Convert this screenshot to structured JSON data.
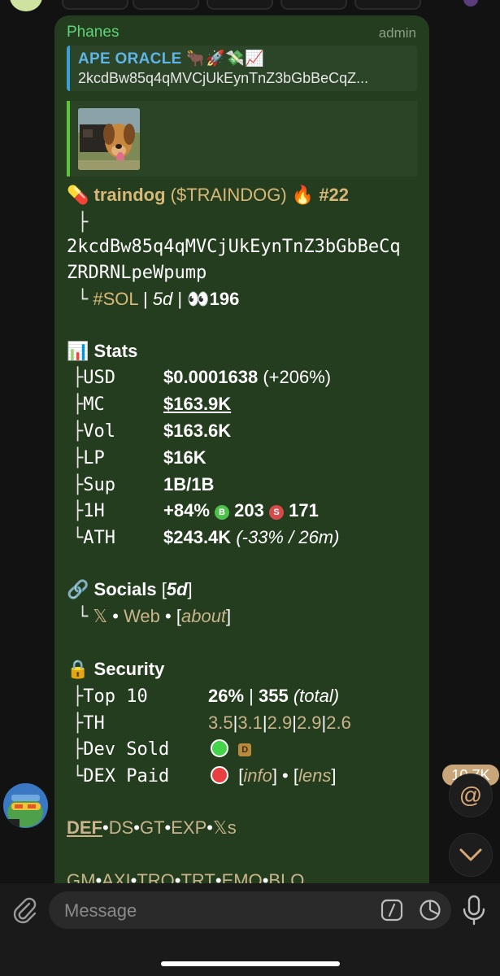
{
  "message": {
    "sender": "Phanes",
    "role": "admin",
    "reply": {
      "title": "APE ORACLE 🐂🚀💸📈",
      "text": "2kcdBw85q4qMVCjUkEynTnZ3bGbBeCqZ..."
    },
    "token": {
      "emoji": "💊",
      "name": "traindog",
      "ticker": "($TRAINDOG)",
      "rank_icon": "🔥",
      "rank": "#22",
      "address_line1": "2kcdBw85q4qMVCjUkEynTnZ3bGbBeCq",
      "address_line2": "ZRDRNLpeWpump",
      "chain": "#SOL",
      "age": "5d",
      "holders_icon": "👀",
      "holders": "196"
    },
    "stats": {
      "header": "Stats",
      "usd_label": "USD",
      "usd_value": "$0.0001638",
      "usd_change": "(+206%)",
      "mc_label": "MC",
      "mc_value": "$163.9K",
      "vol_label": "Vol",
      "vol_value": "$163.6K",
      "lp_label": "LP",
      "lp_value": "$16K",
      "sup_label": "Sup",
      "sup_value": "1B/1B",
      "h1_label": "1H",
      "h1_change": "+84%",
      "buys_badge": "B",
      "buys": "203",
      "sells_badge": "S",
      "sells": "171",
      "ath_label": "ATH",
      "ath_value": "$243.4K",
      "ath_detail": "(-33% / 26m)"
    },
    "socials": {
      "header": "Socials",
      "age": "5d",
      "x": "𝕏",
      "sep": "•",
      "web": "Web",
      "about": "about"
    },
    "security": {
      "header": "Security",
      "top10_label": "Top 10",
      "top10_value": "26%",
      "top10_count": "355",
      "top10_note": "(total)",
      "th_label": "TH",
      "th_values": [
        "3.5",
        "3.1",
        "2.9",
        "2.9",
        "2.6"
      ],
      "dev_label": "Dev Sold",
      "dev_badge": "D",
      "dex_label": "DEX Paid",
      "dex_info": "info",
      "dex_lens": "lens"
    },
    "links_row1": [
      "DEF",
      "DS",
      "GT",
      "EXP",
      "𝕏s"
    ],
    "links_row2": [
      "GM",
      "AXI",
      "TRO",
      "TRT",
      "EMO",
      "BLO"
    ]
  },
  "side": {
    "views_badge": "10.7K",
    "mention_icon": "@"
  },
  "composer": {
    "placeholder": "Message"
  },
  "colors": {
    "bubble": "#233d1e",
    "sender": "#5fd47a",
    "link": "#d8b878",
    "reply_accent": "#3aa0d6"
  }
}
